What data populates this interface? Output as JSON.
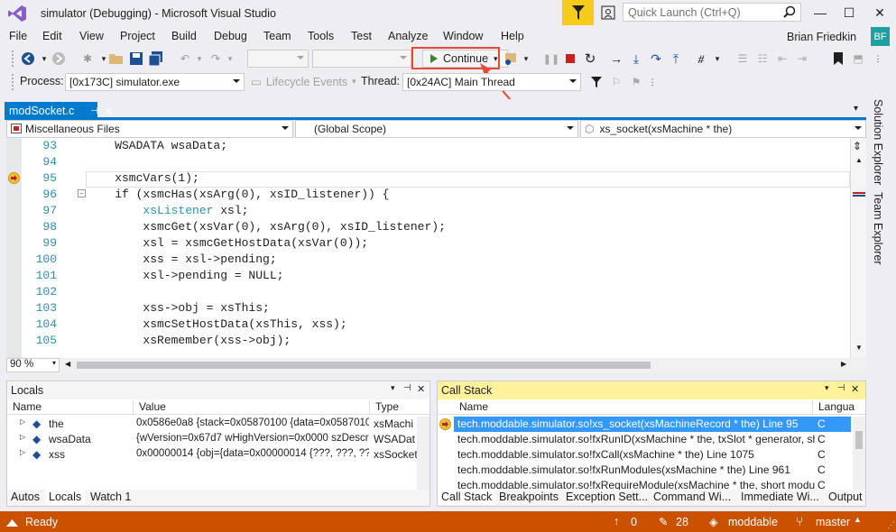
{
  "window": {
    "title": "simulator (Debugging) - Microsoft Visual Studio",
    "quick_launch_placeholder": "Quick Launch (Ctrl+Q)"
  },
  "menu": [
    "File",
    "Edit",
    "View",
    "Project",
    "Build",
    "Debug",
    "Team",
    "Tools",
    "Test",
    "Analyze",
    "Window",
    "Help"
  ],
  "user": {
    "name": "Brian Friedkin",
    "initials": "BF"
  },
  "toolbar": {
    "continue_label": "Continue"
  },
  "debug_bar": {
    "process_label": "Process:",
    "process_value": "[0x173C] simulator.exe",
    "lifecycle_label": "Lifecycle Events",
    "thread_label": "Thread:",
    "thread_value": "[0x24AC] Main Thread"
  },
  "editor": {
    "tab": "modSocket.c",
    "project_scope": "Miscellaneous Files",
    "global_scope": "(Global Scope)",
    "function_scope": "xs_socket(xsMachine * the)",
    "zoom": "90 %",
    "lines": [
      {
        "num": "93",
        "pre": "    WSADATA wsaData;",
        "type": "",
        "post": ""
      },
      {
        "num": "94",
        "pre": "",
        "type": "",
        "post": ""
      },
      {
        "num": "95",
        "pre": "    xsmcVars(1);",
        "type": "",
        "post": ""
      },
      {
        "num": "96",
        "pre": "    if (xsmcHas(xsArg(0), xsID_listener)) {",
        "type": "",
        "post": ""
      },
      {
        "num": "97",
        "pre": "        ",
        "type": "xsListener",
        "post": " xsl;"
      },
      {
        "num": "98",
        "pre": "        xsmcGet(xsVar(0), xsArg(0), xsID_listener);",
        "type": "",
        "post": ""
      },
      {
        "num": "99",
        "pre": "        xsl = xsmcGetHostData(xsVar(0));",
        "type": "",
        "post": ""
      },
      {
        "num": "100",
        "pre": "        xss = xsl->pending;",
        "type": "",
        "post": ""
      },
      {
        "num": "101",
        "pre": "        xsl->pending = NULL;",
        "type": "",
        "post": ""
      },
      {
        "num": "102",
        "pre": "",
        "type": "",
        "post": ""
      },
      {
        "num": "103",
        "pre": "        xss->obj = xsThis;",
        "type": "",
        "post": ""
      },
      {
        "num": "104",
        "pre": "        xsmcSetHostData(xsThis, xss);",
        "type": "",
        "post": ""
      },
      {
        "num": "105",
        "pre": "        xsRemember(xss->obj);",
        "type": "",
        "post": ""
      }
    ]
  },
  "right_rail": [
    "Solution Explorer",
    "Team Explorer"
  ],
  "locals": {
    "title": "Locals",
    "columns": [
      "Name",
      "Value",
      "Type"
    ],
    "rows": [
      {
        "name": "the",
        "value": "0x0586e0a8 {stack=0x05870100 {data=0x05870100",
        "type": "xsMachi"
      },
      {
        "name": "wsaData",
        "value": "{wVersion=0x67d7 wHighVersion=0x0000 szDescri",
        "type": "WSADat"
      },
      {
        "name": "xss",
        "value": "0x00000014 {obj={data=0x00000014 {???, ???, ???, ?",
        "type": "xsSocket"
      }
    ],
    "tabs": [
      "Autos",
      "Locals",
      "Watch 1"
    ]
  },
  "callstack": {
    "title": "Call Stack",
    "columns": [
      "Name",
      "Langua"
    ],
    "rows": [
      {
        "name": "tech.moddable.simulator.so!xs_socket(xsMachineRecord * the) Line 95",
        "lang": "C"
      },
      {
        "name": "tech.moddable.simulator.so!fxRunID(xsMachine * the, txSlot * generator, sh",
        "lang": "C"
      },
      {
        "name": "tech.moddable.simulator.so!fxCall(xsMachine * the) Line 1075",
        "lang": "C"
      },
      {
        "name": "tech.moddable.simulator.so!fxRunModules(xsMachine * the) Line 961",
        "lang": "C"
      },
      {
        "name": "tech.moddable.simulator.so!fxRequireModule(xsMachine * the, short modu",
        "lang": "C"
      }
    ],
    "tabs": [
      "Call Stack",
      "Breakpoints",
      "Exception Sett...",
      "Command Wi...",
      "Immediate Wi...",
      "Output"
    ]
  },
  "status": {
    "ready": "Ready",
    "up_count": "0",
    "edit_count": "28",
    "repo": "moddable",
    "branch": "master"
  },
  "colors": {
    "accent": "#007acc",
    "status": "#ca5100",
    "highlight": "#e8473a"
  }
}
